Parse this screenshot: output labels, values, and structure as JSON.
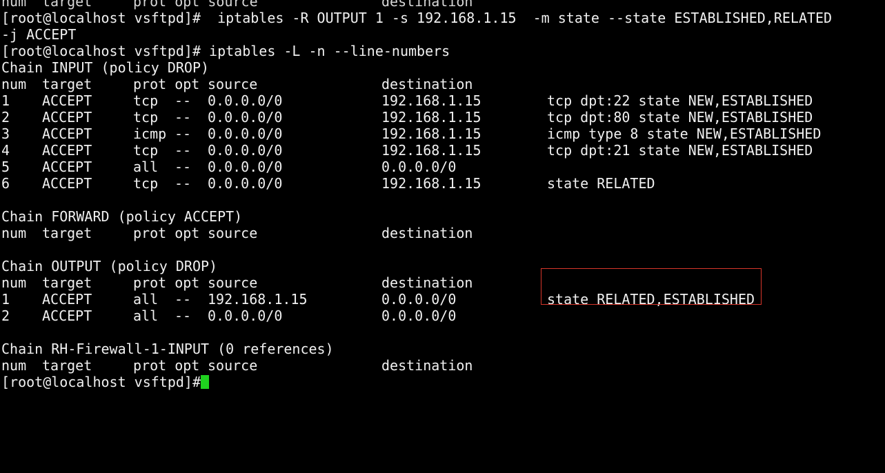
{
  "terminal": {
    "top_partial": {
      "c0": "num",
      "c1": "target",
      "c2": "prot opt source",
      "c3": "destination"
    },
    "cmd1": {
      "line1": "[root@localhost vsftpd]#  iptables -R OUTPUT 1 -s 192.168.1.15  -m state --state ESTABLISHED,RELATED",
      "line2": "-j ACCEPT"
    },
    "cmd2": "[root@localhost vsftpd]# iptables -L -n --line-numbers",
    "chains": {
      "input": {
        "title": "Chain INPUT (policy DROP)",
        "header": {
          "num": "num",
          "target": "target",
          "protopt": "prot opt",
          "source": "source",
          "destination": "destination"
        },
        "rows": [
          {
            "num": "1",
            "target": "ACCEPT",
            "prot": "tcp",
            "opt": "--",
            "source": "0.0.0.0/0",
            "destination": "192.168.1.15",
            "extra": "tcp dpt:22 state NEW,ESTABLISHED"
          },
          {
            "num": "2",
            "target": "ACCEPT",
            "prot": "tcp",
            "opt": "--",
            "source": "0.0.0.0/0",
            "destination": "192.168.1.15",
            "extra": "tcp dpt:80 state NEW,ESTABLISHED"
          },
          {
            "num": "3",
            "target": "ACCEPT",
            "prot": "icmp",
            "opt": "--",
            "source": "0.0.0.0/0",
            "destination": "192.168.1.15",
            "extra": "icmp type 8 state NEW,ESTABLISHED"
          },
          {
            "num": "4",
            "target": "ACCEPT",
            "prot": "tcp",
            "opt": "--",
            "source": "0.0.0.0/0",
            "destination": "192.168.1.15",
            "extra": "tcp dpt:21 state NEW,ESTABLISHED"
          },
          {
            "num": "5",
            "target": "ACCEPT",
            "prot": "all",
            "opt": "--",
            "source": "0.0.0.0/0",
            "destination": "0.0.0.0/0",
            "extra": ""
          },
          {
            "num": "6",
            "target": "ACCEPT",
            "prot": "tcp",
            "opt": "--",
            "source": "0.0.0.0/0",
            "destination": "192.168.1.15",
            "extra": "state RELATED"
          }
        ]
      },
      "forward": {
        "title": "Chain FORWARD (policy ACCEPT)",
        "header": {
          "num": "num",
          "target": "target",
          "protopt": "prot opt",
          "source": "source",
          "destination": "destination"
        }
      },
      "output": {
        "title": "Chain OUTPUT (policy DROP)",
        "header": {
          "num": "num",
          "target": "target",
          "protopt": "prot opt",
          "source": "source",
          "destination": "destination"
        },
        "rows": [
          {
            "num": "1",
            "target": "ACCEPT",
            "prot": "all",
            "opt": "--",
            "source": "192.168.1.15",
            "destination": "0.0.0.0/0",
            "extra": "state RELATED,ESTABLISHED"
          },
          {
            "num": "2",
            "target": "ACCEPT",
            "prot": "all",
            "opt": "--",
            "source": "0.0.0.0/0",
            "destination": "0.0.0.0/0",
            "extra": ""
          }
        ]
      },
      "rh": {
        "title": "Chain RH-Firewall-1-INPUT (0 references)",
        "header": {
          "num": "num",
          "target": "target",
          "protopt": "prot opt",
          "source": "source",
          "destination": "destination"
        }
      }
    },
    "prompt_partial": "[root@localhost vsftpd]#"
  },
  "colors": {
    "background": "#000000",
    "text": "#f0f0f0",
    "cursor": "#1fd11f",
    "highlight_border": "#d9362b"
  }
}
